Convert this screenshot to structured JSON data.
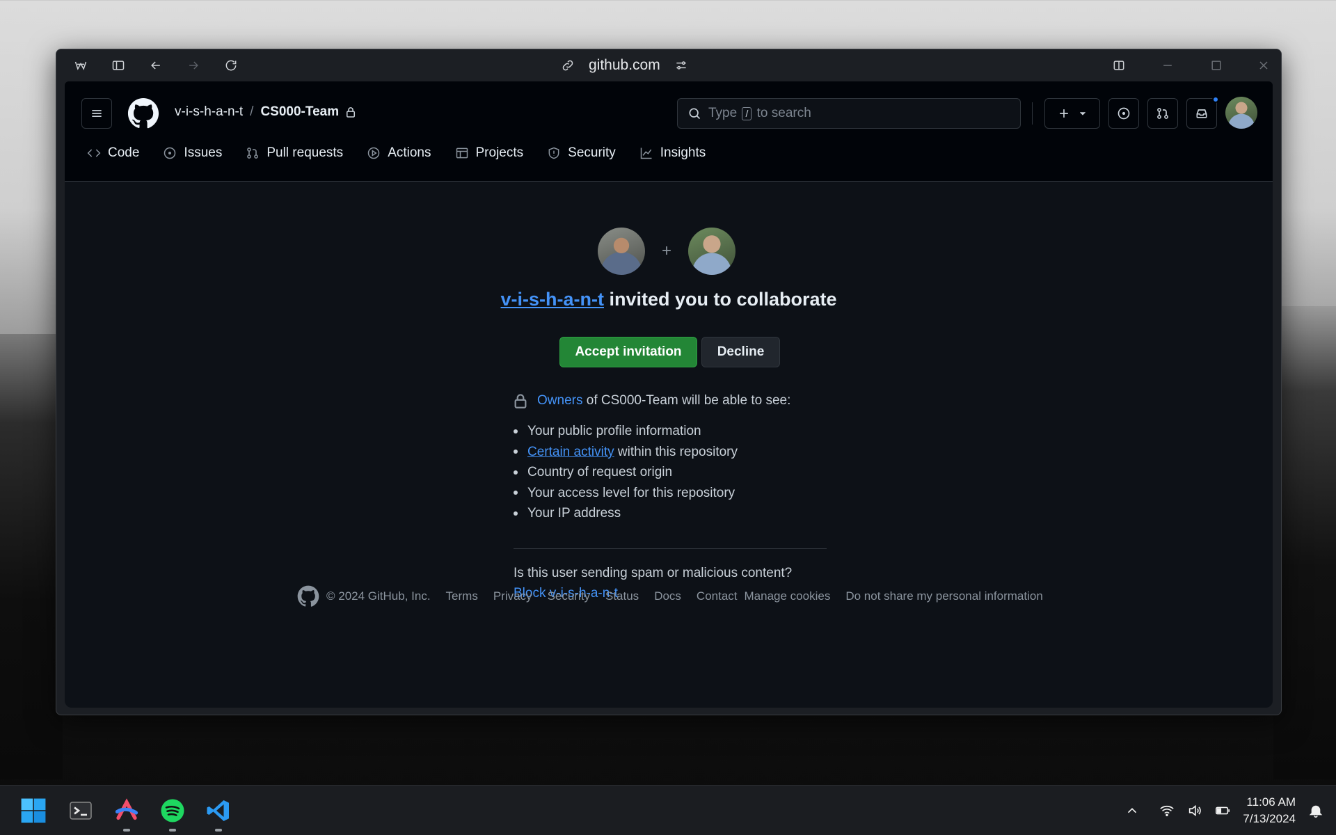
{
  "browser": {
    "url": "github.com"
  },
  "header": {
    "owner": "v-i-s-h-a-n-t",
    "separator": "/",
    "repo": "CS000-Team",
    "search_placeholder_before": "Type",
    "search_key": "/",
    "search_placeholder_after": "to search"
  },
  "nav": {
    "items": [
      {
        "label": "Code",
        "icon": "code-icon"
      },
      {
        "label": "Issues",
        "icon": "issue-icon"
      },
      {
        "label": "Pull requests",
        "icon": "pull-request-icon"
      },
      {
        "label": "Actions",
        "icon": "play-icon"
      },
      {
        "label": "Projects",
        "icon": "table-icon"
      },
      {
        "label": "Security",
        "icon": "shield-icon"
      },
      {
        "label": "Insights",
        "icon": "graph-icon"
      }
    ]
  },
  "invite": {
    "plus": "+",
    "inviter": "v-i-s-h-a-n-t",
    "headline_rest": " invited you to collaborate",
    "accept_label": "Accept invitation",
    "decline_label": "Decline",
    "owners_link": "Owners",
    "owners_rest": "of CS000-Team will be able to see:",
    "list": {
      "item1": "Your public profile information",
      "item2_link": "Certain activity",
      "item2_rest": "within this repository",
      "item3": "Country of request origin",
      "item4": "Your access level for this repository",
      "item5": "Your IP address"
    },
    "spam_question": "Is this user sending spam or malicious content?",
    "block_label": "Block v-i-s-h-a-n-t"
  },
  "footer": {
    "copyright": "© 2024 GitHub, Inc.",
    "links": [
      "Terms",
      "Privacy",
      "Security",
      "Status",
      "Docs",
      "Contact",
      "Manage cookies",
      "Do not share my personal information"
    ]
  },
  "taskbar": {
    "time": "11:06 AM",
    "date": "7/13/2024"
  },
  "colors": {
    "accent_link": "#4493f8",
    "accept_green": "#238636",
    "page_bg": "#0d1117",
    "header_bg": "#010409"
  }
}
